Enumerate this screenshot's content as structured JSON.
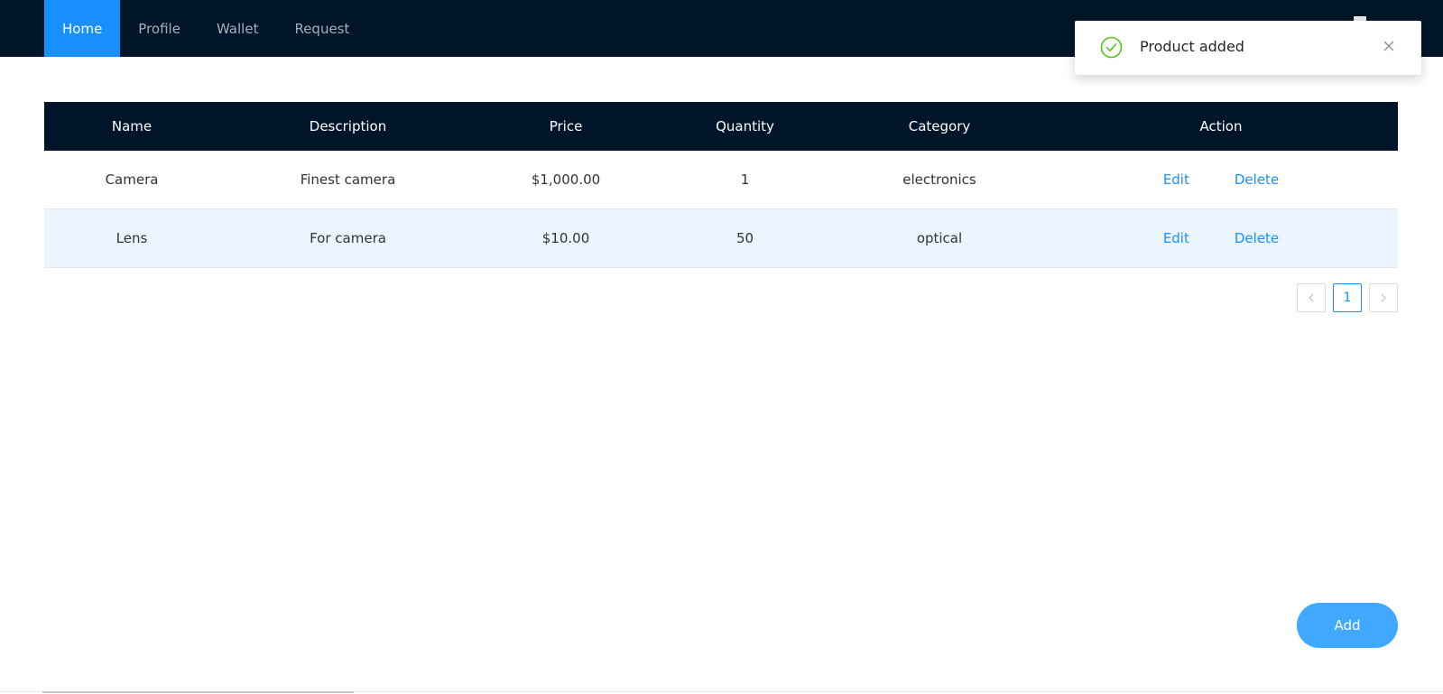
{
  "nav": {
    "items": [
      {
        "label": "Home",
        "active": true
      },
      {
        "label": "Profile",
        "active": false
      },
      {
        "label": "Wallet",
        "active": false
      },
      {
        "label": "Request",
        "active": false
      }
    ]
  },
  "table": {
    "headers": {
      "name": "Name",
      "description": "Description",
      "price": "Price",
      "quantity": "Quantity",
      "category": "Category",
      "action": "Action"
    },
    "rows": [
      {
        "name": "Camera",
        "description": "Finest camera",
        "price": "$1,000.00",
        "quantity": "1",
        "category": "electronics",
        "edit": "Edit",
        "delete": "Delete"
      },
      {
        "name": "Lens",
        "description": "For camera",
        "price": "$10.00",
        "quantity": "50",
        "category": "optical",
        "edit": "Edit",
        "delete": "Delete"
      }
    ]
  },
  "pagination": {
    "current_page": "1",
    "prev_icon": "chevron-left-icon",
    "next_icon": "chevron-right-icon"
  },
  "add_button": {
    "label": "Add"
  },
  "notification": {
    "message": "Product added",
    "icon": "check-circle-icon",
    "close_icon": "close-icon"
  },
  "colors": {
    "nav_bg": "#001529",
    "accent": "#1890ff",
    "success": "#52c41a",
    "row_hover": "#eaf5ff"
  }
}
